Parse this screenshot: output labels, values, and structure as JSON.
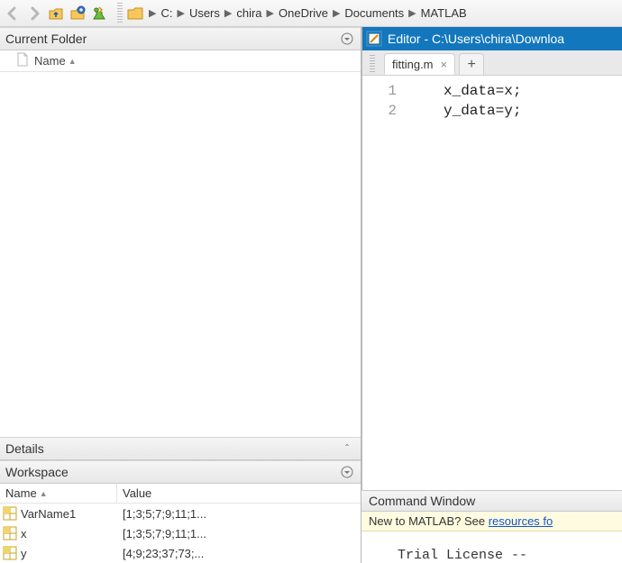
{
  "breadcrumb": [
    "C:",
    "Users",
    "chira",
    "OneDrive",
    "Documents",
    "MATLAB"
  ],
  "panels": {
    "currentFolder": {
      "title": "Current Folder",
      "nameHeader": "Name"
    },
    "details": {
      "title": "Details"
    },
    "workspace": {
      "title": "Workspace",
      "columns": {
        "name": "Name",
        "value": "Value"
      },
      "rows": [
        {
          "name": "VarName1",
          "value": "[1;3;5;7;9;11;1..."
        },
        {
          "name": "x",
          "value": "[1;3;5;7;9;11;1..."
        },
        {
          "name": "y",
          "value": "[4;9;23;37;73;..."
        }
      ]
    }
  },
  "editor": {
    "title": "Editor - C:\\Users\\chira\\Downloa",
    "tab": "fitting.m",
    "lines": [
      {
        "n": "1",
        "text": "x_data=x;"
      },
      {
        "n": "2",
        "text": "y_data=y;"
      }
    ]
  },
  "commandWindow": {
    "title": "Command Window",
    "hintPrefix": "New to MATLAB? See ",
    "hintLink": "resources fo",
    "body": "Trial License --"
  },
  "icons": {
    "folder": "folder-icon",
    "file": "file-icon",
    "up": "up-folder-icon",
    "find": "find-files-icon"
  }
}
